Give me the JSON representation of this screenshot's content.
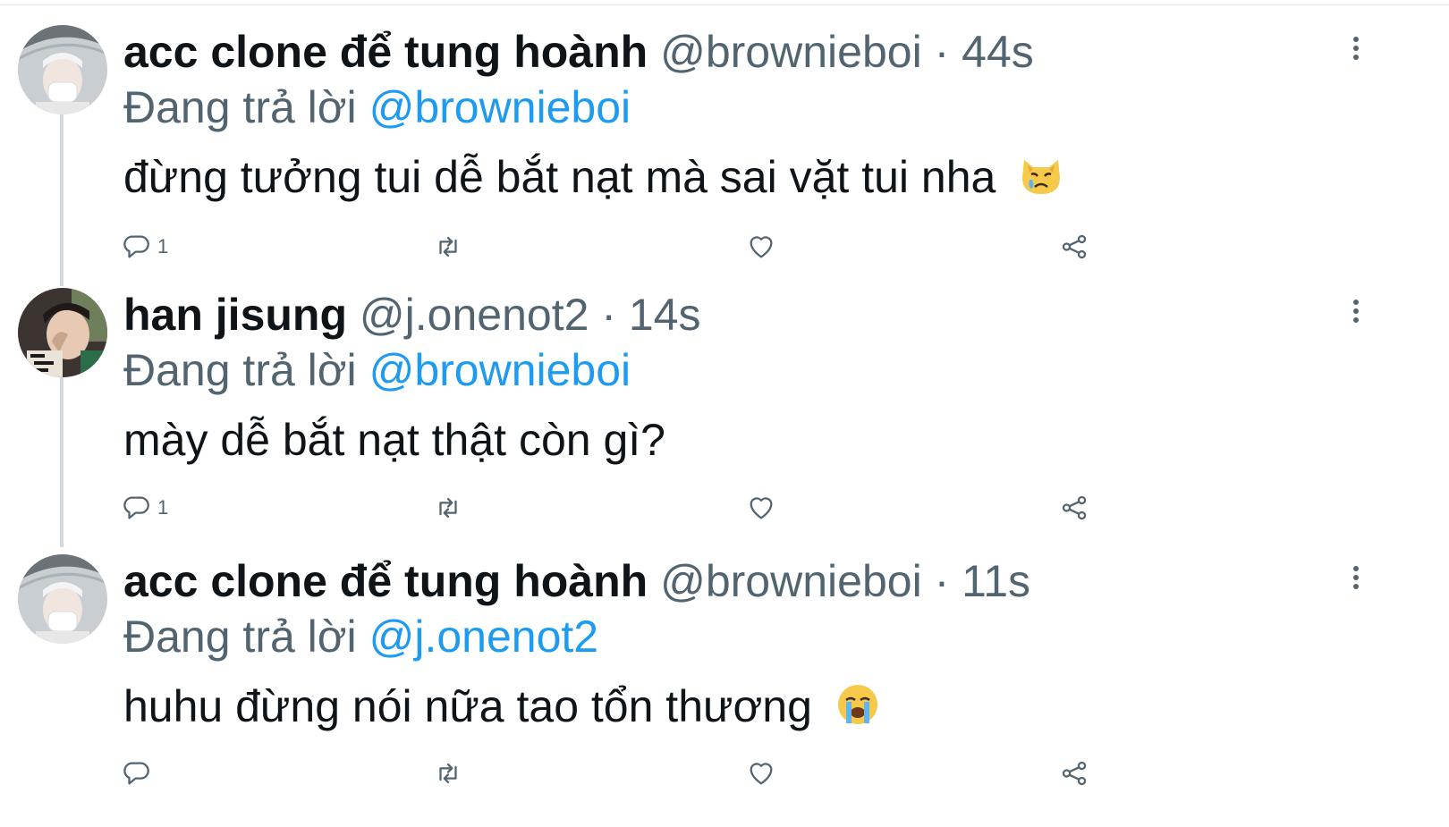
{
  "replying_label": "Đang trả lời",
  "tweets": [
    {
      "name": "acc clone để tung hoành",
      "handle": "@brownieboi",
      "separator": "·",
      "time": "44s",
      "reply_to": "@brownieboi",
      "text": "đừng tưởng tui dễ bắt nạt mà sai vặt tui nha",
      "emoji": "crying-cat-face",
      "reply_count": "1"
    },
    {
      "name": "han jisung",
      "handle": "@j.onenot2",
      "separator": "·",
      "time": "14s",
      "reply_to": "@brownieboi",
      "text": "mày dễ bắt nạt thật còn gì?",
      "emoji": "",
      "reply_count": "1"
    },
    {
      "name": "acc clone để tung hoành",
      "handle": "@brownieboi",
      "separator": "·",
      "time": "11s",
      "reply_to": "@j.onenot2",
      "text": "huhu đừng nói nữa tao tổn thương",
      "emoji": "loudly-crying-face",
      "reply_count": ""
    }
  ],
  "colors": {
    "text": "#0f1419",
    "secondary": "#536471",
    "link": "#1d9bf0",
    "thread_line": "#cfd9de"
  }
}
